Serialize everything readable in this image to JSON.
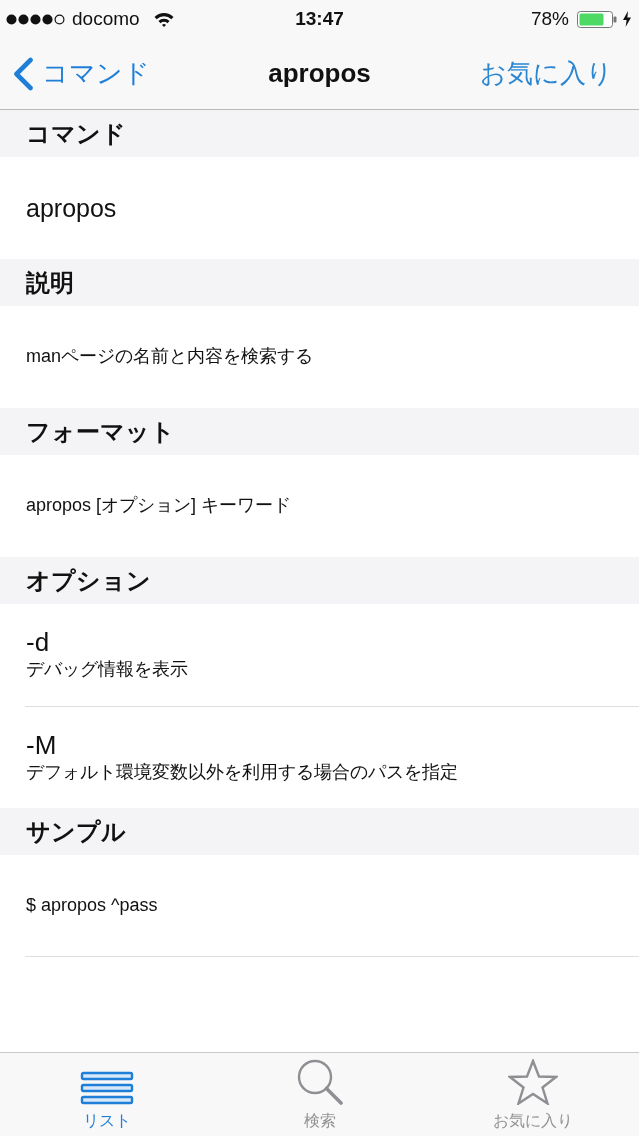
{
  "status_bar": {
    "carrier": "docomo",
    "time": "13:47",
    "battery": "78%"
  },
  "nav_bar": {
    "back": "コマンド",
    "title": "apropos",
    "action": "お気に入り"
  },
  "sections": [
    {
      "header": "コマンド",
      "rows": [
        {
          "kind": "title",
          "text": "apropos"
        }
      ]
    },
    {
      "header": "説明",
      "rows": [
        {
          "kind": "text",
          "text": "manページの名前と内容を検索する"
        }
      ]
    },
    {
      "header": "フォーマット",
      "rows": [
        {
          "kind": "text",
          "text": "apropos [オプション] キーワード"
        }
      ]
    },
    {
      "header": "オプション",
      "rows": [
        {
          "kind": "option",
          "name": "-d",
          "description": "デバッグ情報を表示"
        },
        {
          "kind": "option",
          "name": "-M",
          "description": "デフォルト環境変数以外を利用する場合のパスを指定"
        }
      ]
    },
    {
      "header": "サンプル",
      "rows": [
        {
          "kind": "text",
          "text": "$ apropos ^pass"
        }
      ]
    }
  ],
  "tabs": [
    {
      "label": "リスト",
      "selected": true
    },
    {
      "label": "検索",
      "selected": false
    },
    {
      "label": "お気に入り",
      "selected": false
    }
  ]
}
